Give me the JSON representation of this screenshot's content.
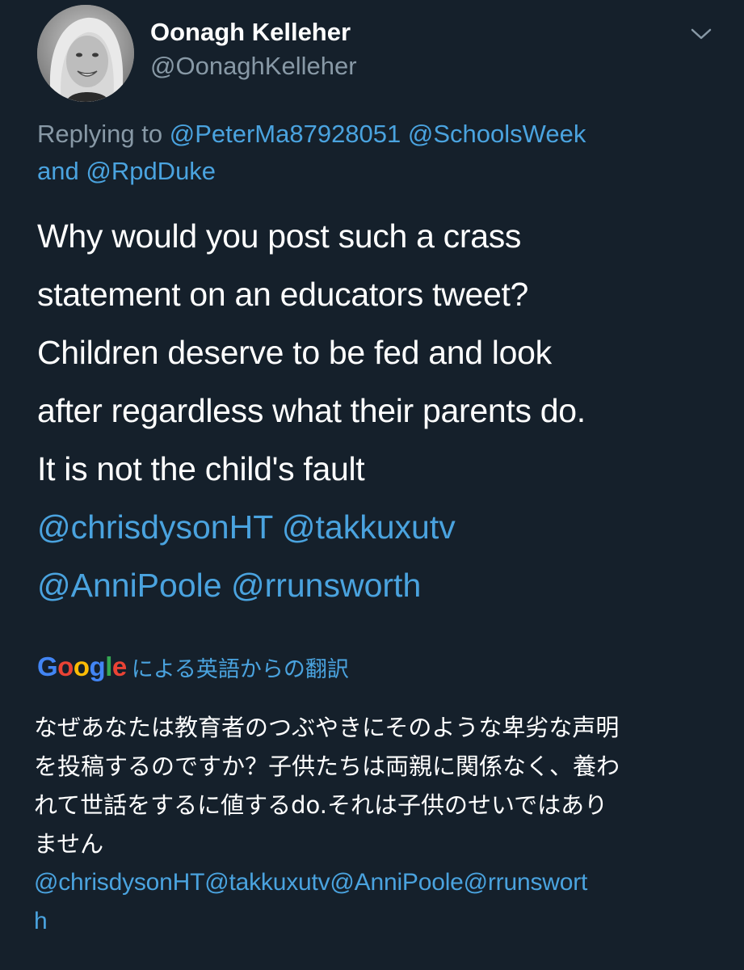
{
  "author": {
    "display_name": "Oonagh Kelleher",
    "handle": "@OonaghKelleher",
    "avatar_icon": "profile-photo",
    "menu_icon": "chevron-down-icon"
  },
  "reply_context": {
    "prefix": "Replying to ",
    "mention_1": "@PeterMa87928051",
    "mention_2": "@SchoolsWeek",
    "joiner": "and ",
    "mention_3": "@RpdDuke"
  },
  "tweet": {
    "lines": [
      "Why would you post such a crass",
      "statement on an educators tweet?",
      "Children deserve to be fed and look",
      "after regardless what their parents do.",
      "It is not the child's fault"
    ],
    "mentions_line_1": [
      "@chrisdysonHT",
      "@takkuxutv"
    ],
    "mentions_line_2": [
      "@AnniPoole",
      "@rrunsworth"
    ]
  },
  "translation": {
    "logo_letters": [
      "G",
      "o",
      "o",
      "g",
      "l",
      "e"
    ],
    "label": "による英語からの翻訳",
    "lines": [
      "なぜあなたは教育者のつぶやきにそのような卑劣な声明",
      "を投稿するのですか？子供たちは両親に関係なく、養わ",
      "れて世話をするに値するdo.それは子供のせいではあり",
      "ません"
    ],
    "mention_lines": [
      "@chrisdysonHT@takkuxutv@AnniPoole@rrunswort",
      "h"
    ]
  },
  "colors": {
    "background": "#15202b",
    "link": "#4aa3df",
    "secondary_text": "#8899a6",
    "primary_text": "#ffffff"
  }
}
